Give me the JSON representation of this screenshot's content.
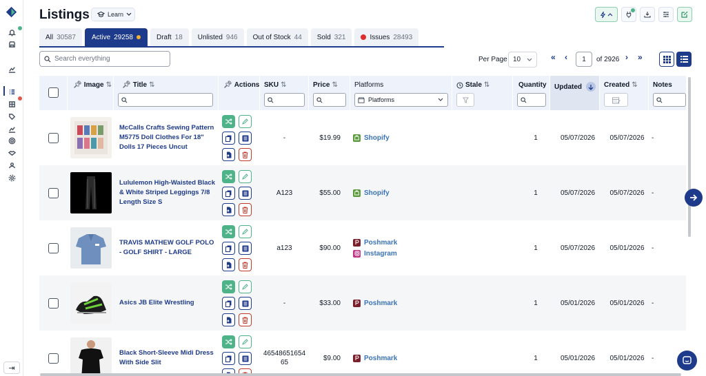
{
  "header": {
    "title": "Listings",
    "learn_label": "Learn"
  },
  "tabs": [
    {
      "label": "All",
      "count": "30587"
    },
    {
      "label": "Active",
      "count": "29258"
    },
    {
      "label": "Draft",
      "count": "18"
    },
    {
      "label": "Unlisted",
      "count": "946"
    },
    {
      "label": "Out of Stock",
      "count": "44"
    },
    {
      "label": "Sold",
      "count": "321"
    },
    {
      "label": "Issues",
      "count": "28493"
    }
  ],
  "search": {
    "placeholder": "Search everything"
  },
  "pagination": {
    "per_page_label": "Per Page",
    "per_page": "10",
    "current_page": "1",
    "of_label": "of 2926"
  },
  "columns": {
    "image": "Image",
    "title": "Title",
    "actions": "Actions",
    "sku": "SKU",
    "price": "Price",
    "platforms": "Platforms",
    "platforms_filter": "Platforms",
    "stale": "Stale",
    "quantity": "Quantity",
    "updated": "Updated",
    "created": "Created",
    "notes": "Notes"
  },
  "rows": [
    {
      "title": "McCalls Crafts Sewing Pattern M5775 Doll Clothes For 18\" Dolls 17 Pieces Uncut",
      "sku": "-",
      "price": "$19.99",
      "platforms": [
        "Shopify"
      ],
      "quantity": "1",
      "updated": "05/07/2026",
      "created": "05/07/2026",
      "notes": "-"
    },
    {
      "title": "Lululemon High-Waisted Black & White Striped Leggings 7/8 Length Size S",
      "sku": "A123",
      "price": "$55.00",
      "platforms": [
        "Shopify"
      ],
      "quantity": "1",
      "updated": "05/07/2026",
      "created": "05/07/2026",
      "notes": "-"
    },
    {
      "title": "TRAVIS MATHEW GOLF POLO - GOLF SHIRT - LARGE",
      "sku": "a123",
      "price": "$90.00",
      "platforms": [
        "Poshmark",
        "Instagram"
      ],
      "quantity": "1",
      "updated": "05/07/2026",
      "created": "05/01/2026",
      "notes": "-"
    },
    {
      "title": "Asics JB Elite Wrestling",
      "sku": "-",
      "price": "$33.00",
      "platforms": [
        "Poshmark"
      ],
      "quantity": "1",
      "updated": "05/01/2026",
      "created": "05/01/2026",
      "notes": "-"
    },
    {
      "title": "Black Short-Sleeve Midi Dress With Side Slit",
      "sku": "4654865165465",
      "price": "$9.00",
      "platforms": [
        "Poshmark"
      ],
      "quantity": "1",
      "updated": "05/01/2026",
      "created": "05/01/2026",
      "notes": "-"
    }
  ],
  "colors": {
    "navy": "#1e3a8a",
    "green": "#4fb38a",
    "red": "#c0392b",
    "shopify": "#5a9a3a",
    "poshmark": "#7a1f2b",
    "instagram": "#c13584",
    "link": "#3b74b8"
  }
}
